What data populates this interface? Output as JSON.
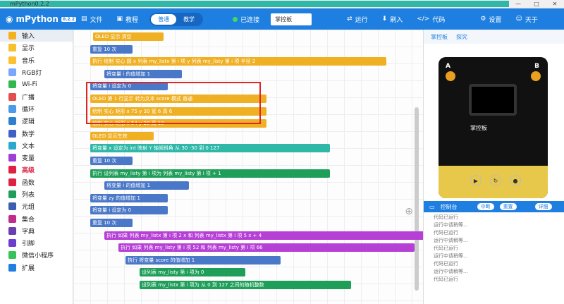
{
  "window": {
    "title": "mPython0.2.2",
    "controls": [
      "—",
      "□",
      "✕"
    ]
  },
  "toolbar": {
    "logo": "mPython",
    "logo_badge": "0.2.2",
    "file": "文件",
    "tutorial": "教程",
    "mode_normal": "普通",
    "mode_teach": "教学",
    "status": "已连接",
    "board": "掌控板",
    "run": "运行",
    "flash": "刷入",
    "code": "代码",
    "settings": "设置",
    "user": "天于"
  },
  "sidebar": [
    {
      "label": "输入",
      "color": "#f5b01e"
    },
    {
      "label": "显示",
      "color": "#f7c02e"
    },
    {
      "label": "音乐",
      "color": "#ffbf33"
    },
    {
      "label": "RGB灯",
      "color": "#7aa6ff"
    },
    {
      "label": "Wi-Fi",
      "color": "#31b84d"
    },
    {
      "label": "广播",
      "color": "#e05050"
    },
    {
      "label": "循环",
      "color": "#4b9be8"
    },
    {
      "label": "逻辑",
      "color": "#2d7fd0"
    },
    {
      "label": "数学",
      "color": "#4060c8"
    },
    {
      "label": "文本",
      "color": "#2aa8d0"
    },
    {
      "label": "变量",
      "color": "#9b3fd6"
    },
    {
      "label": "高级",
      "color": "#d24"
    },
    {
      "label": "函数",
      "color": "#d24"
    },
    {
      "label": "列表",
      "color": "#1f9e5a"
    },
    {
      "label": "元组",
      "color": "#3a5fb0"
    },
    {
      "label": "集合",
      "color": "#c02e8c"
    },
    {
      "label": "字典",
      "color": "#6a3fb0"
    },
    {
      "label": "引脚",
      "color": "#6a3fd0"
    },
    {
      "label": "微信小程序",
      "color": "#35c45a"
    },
    {
      "label": "扩展",
      "color": "#1f7fe0"
    }
  ],
  "blocks": [
    {
      "text": "OLED 显示 清空",
      "cls": "y"
    },
    {
      "text": "重复 10 次",
      "cls": "b"
    },
    {
      "text": "执行  绘制 实心 圆 x 列表 my_listx 第 i 项  y 列表 my_listy 第 i 项  半径 2",
      "cls": "y"
    },
    {
      "text": "将变量 i 的值增加 1",
      "cls": "b"
    },
    {
      "text": "将变量 i 设定为 0",
      "cls": "b"
    },
    {
      "text": "OLED 第 1 行显示 转为文本 score 模式 普通",
      "cls": "y"
    },
    {
      "text": "绘制 实心 矩形 x 75 y 30 宽 6 高 6",
      "cls": "y"
    },
    {
      "text": "绘制 实心 矩形 x 54 y 20 高 10",
      "cls": "y"
    },
    {
      "text": "OLED 显示生效",
      "cls": "y"
    },
    {
      "text": "将变量 x 设定为 int 映射 Y 轴倾斜角 从 30 -30 到 0 127",
      "cls": "t"
    },
    {
      "text": "重复 10 次",
      "cls": "b"
    },
    {
      "text": "执行 设列表 my_listy 第 i 项为 列表 my_listy 第 i 项 + 1",
      "cls": "g"
    },
    {
      "text": "将变量 i 的值增加 1",
      "cls": "b"
    },
    {
      "text": "将变量 zy 的值增加 1",
      "cls": "b"
    },
    {
      "text": "将变量 i 设定为 0",
      "cls": "b"
    },
    {
      "text": "重复 10 次",
      "cls": "b"
    },
    {
      "text": "执行 如果 列表 my_listx 第 i 项 2 x 和 列表 my_listx 第 i 项 5 x + 4",
      "cls": "p"
    },
    {
      "text": "执行 如果 列表 my_listy 第 i 项 52 和 列表 my_listy 第 i 项 66",
      "cls": "p"
    },
    {
      "text": "执行 将变量 score 的值增加 1",
      "cls": "b"
    },
    {
      "text": "设列表 my_listy 第 i 项为 0",
      "cls": "g"
    },
    {
      "text": "设列表 my_listx 第 i 项为 从 0 到 127 之间的随机整数",
      "cls": "g"
    }
  ],
  "right": {
    "tab1": "掌控板",
    "tab2": "探究",
    "pin_a": "A",
    "pin_b": "B",
    "board_brand": "掌控板",
    "console": "控制台",
    "btn_mid": "中断",
    "btn_reset": "重置",
    "toggle": "详细",
    "logs": [
      "代码已运行",
      "运行中请稍等...",
      "代码已运行",
      "运行中请稍等...",
      "代码已运行",
      "运行中请稍等...",
      "代码已运行",
      "运行中请稍等...",
      "代码已运行"
    ]
  }
}
